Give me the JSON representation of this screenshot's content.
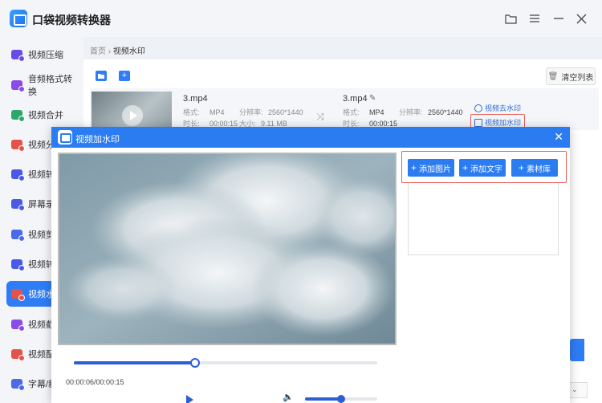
{
  "app": {
    "title": "口袋视频转换器"
  },
  "sidebar": {
    "items": [
      {
        "label": "视频压缩",
        "color": "#6a4be6"
      },
      {
        "label": "音频格式转换",
        "color": "#8a4be6"
      },
      {
        "label": "视频合并",
        "color": "#2ea86a"
      },
      {
        "label": "视频分",
        "color": "#e2534a"
      },
      {
        "label": "视频转",
        "color": "#4a5ae6"
      },
      {
        "label": "屏幕录",
        "color": "#4a5ae6"
      },
      {
        "label": "视频剪",
        "color": "#4a6ae6"
      },
      {
        "label": "视频转",
        "color": "#4a5ae6"
      },
      {
        "label": "视频水",
        "color": "#e2534a",
        "active": true
      },
      {
        "label": "视频截",
        "color": "#8a4be6"
      },
      {
        "label": "视频配",
        "color": "#e2534a"
      },
      {
        "label": "字幕/新",
        "color": "#4a6ae6"
      }
    ]
  },
  "breadcrumb": {
    "home": "首页",
    "sep": "›",
    "current": "视频水印"
  },
  "toolbar": {
    "clear_label": "清空列表"
  },
  "file": {
    "source": {
      "name": "3.mp4",
      "format_label": "格式:",
      "format": "MP4",
      "res_label": "分辨率:",
      "res": "2560*1440",
      "dur_label": "时长:",
      "dur": "00:00:15",
      "size_label": "大小:",
      "size": "9.11 MB"
    },
    "output": {
      "name": "3.mp4",
      "format_label": "格式:",
      "format": "MP4",
      "res_label": "分辨率:",
      "res": "2560*1440",
      "dur_label": "时长:",
      "dur": "00:00:15"
    },
    "actions": {
      "remove_wm": "视频去水印",
      "add_wm": "视频加水印"
    }
  },
  "modal": {
    "title": "视频加水印",
    "buttons": {
      "add_image": "添加图片",
      "add_text": "添加文字",
      "library": "素材库"
    },
    "player": {
      "time": "00:00:06/00:00:15",
      "progress": 0.4,
      "volume": 0.5
    }
  },
  "accent": "#2b7cf1"
}
